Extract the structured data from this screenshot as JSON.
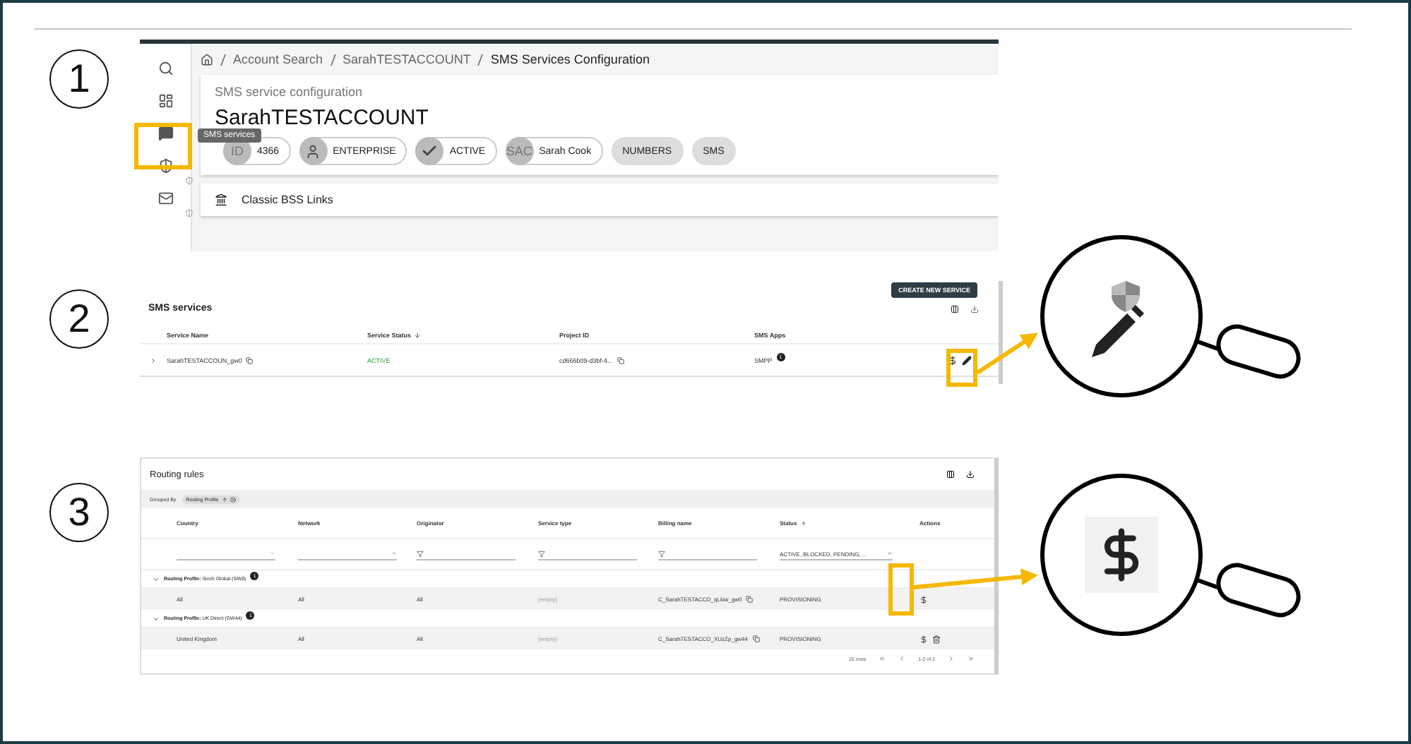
{
  "steps": [
    {
      "number": "1"
    },
    {
      "number": "2"
    },
    {
      "number": "3"
    }
  ],
  "config_screen": {
    "breadcrumb": [
      "Account Search",
      "SarahTESTACCOUNT",
      "SMS Services Configuration"
    ],
    "subtitle": "SMS service configuration",
    "title": "SarahTESTACCOUNT",
    "tooltip": "SMS services",
    "chips": [
      {
        "kind": "text",
        "avatar": "ID",
        "label": "4366"
      },
      {
        "kind": "person",
        "label": "ENTERPRISE"
      },
      {
        "kind": "check",
        "label": "ACTIVE"
      },
      {
        "kind": "text",
        "avatar": "SAC",
        "label": "Sarah Cook"
      },
      {
        "kind": "plain",
        "label": "NUMBERS"
      },
      {
        "kind": "plain",
        "label": "SMS"
      }
    ],
    "links_section": "Classic BSS Links"
  },
  "services_screen": {
    "create_button": "CREATE NEW SERVICE",
    "title": "SMS services",
    "columns": [
      "Service Name",
      "Service Status",
      "Project ID",
      "SMS Apps"
    ],
    "rows": [
      {
        "service_name": "SarahTESTACCOUN_gw0",
        "status": "ACTIVE",
        "project_id": "cd666b09-d3bf-4...",
        "sms_apps": "SMPP",
        "apps_badge": "1"
      }
    ]
  },
  "routing_screen": {
    "title": "Routing rules",
    "grouped_by": "Grouped By",
    "group_chip": "Routing Profile",
    "columns": [
      "Country",
      "Network",
      "Originator",
      "Service type",
      "Billing name",
      "Status",
      "Actions"
    ],
    "status_filter": "ACTIVE, BLOCKED, PENDING,...",
    "groups": [
      {
        "label": "**Routing Profile:** Sinch Global (GW0)",
        "badge": "1",
        "rows": [
          {
            "country": "All",
            "network": "All",
            "originator": "All",
            "service_type": "(empty)",
            "billing_name": "C_SarahTESTACCO_qLkiw_gw0",
            "status": "PROVISIONING"
          }
        ]
      },
      {
        "label": "**Routing Profile:** UK Direct (GW44)",
        "badge": "1",
        "rows": [
          {
            "country": "United Kingdom",
            "network": "All",
            "originator": "All",
            "service_type": "(empty)",
            "billing_name": "C_SarahTESTACCO_XUzZp_gw44",
            "status": "PROVISIONING"
          }
        ]
      }
    ],
    "pagination": {
      "rows": "10 rows",
      "range": "1-2 of 2"
    }
  }
}
